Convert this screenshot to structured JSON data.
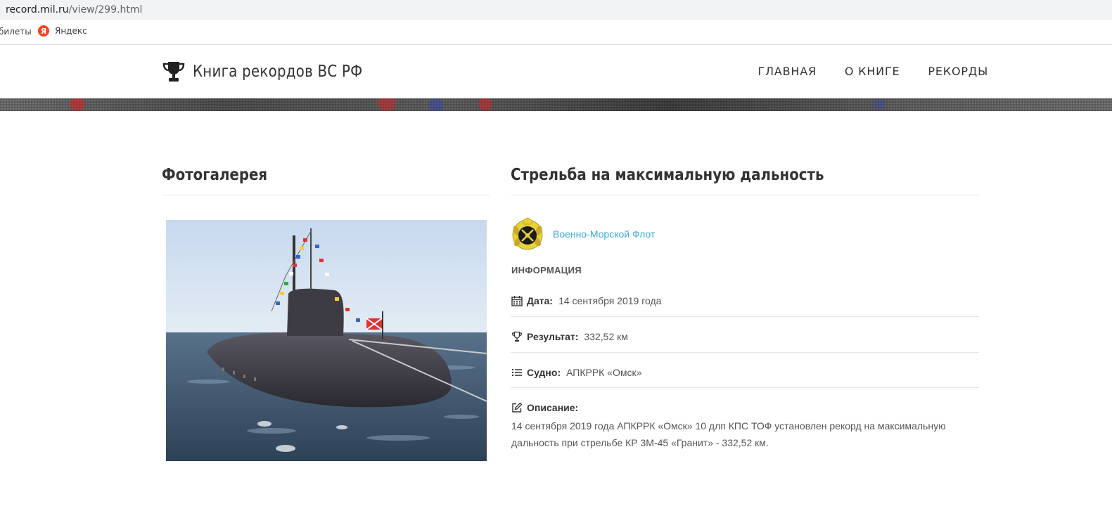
{
  "browser": {
    "url_host": "record.mil.ru",
    "url_path": "/view/299.html",
    "bookmarks": [
      {
        "label": "билеты"
      },
      {
        "label": "Яндекс",
        "icon": "yandex-icon",
        "icon_letter": "Я"
      }
    ]
  },
  "header": {
    "logo_text": "Книга рекордов ВС РФ",
    "logo_icon": "trophy-icon",
    "nav": [
      {
        "label": "ГЛАВНАЯ"
      },
      {
        "label": "О КНИГЕ"
      },
      {
        "label": "РЕКОРДЫ"
      }
    ]
  },
  "gallery": {
    "title": "Фотогалерея",
    "photo_subject": "submarine"
  },
  "record": {
    "title": "Стрельба на максимальную дальность",
    "branch": {
      "name": "Военно-Морской Флот",
      "icon": "navy-emblem-icon"
    },
    "info_heading": "ИНФОРМАЦИЯ",
    "rows": [
      {
        "label": "Дата:",
        "value": "14 сентября 2019 года",
        "icon": "calendar-icon"
      },
      {
        "label": "Результат:",
        "value": "332,52 км",
        "icon": "trophy-icon"
      },
      {
        "label": "Судно:",
        "value": "АПКРРК «Омск»",
        "icon": "list-icon"
      }
    ],
    "description": {
      "label": "Описание:",
      "icon": "edit-icon",
      "text": "14 сентября 2019 года АПКРРК «Омск» 10 длп КПС ТОФ установлен рекорд на максимальную дальность при стрельбе КР 3М-45 «Гранит» - 332,52 км."
    }
  },
  "colors": {
    "link": "#3fa9d6",
    "text": "#333333",
    "muted": "#555555"
  }
}
